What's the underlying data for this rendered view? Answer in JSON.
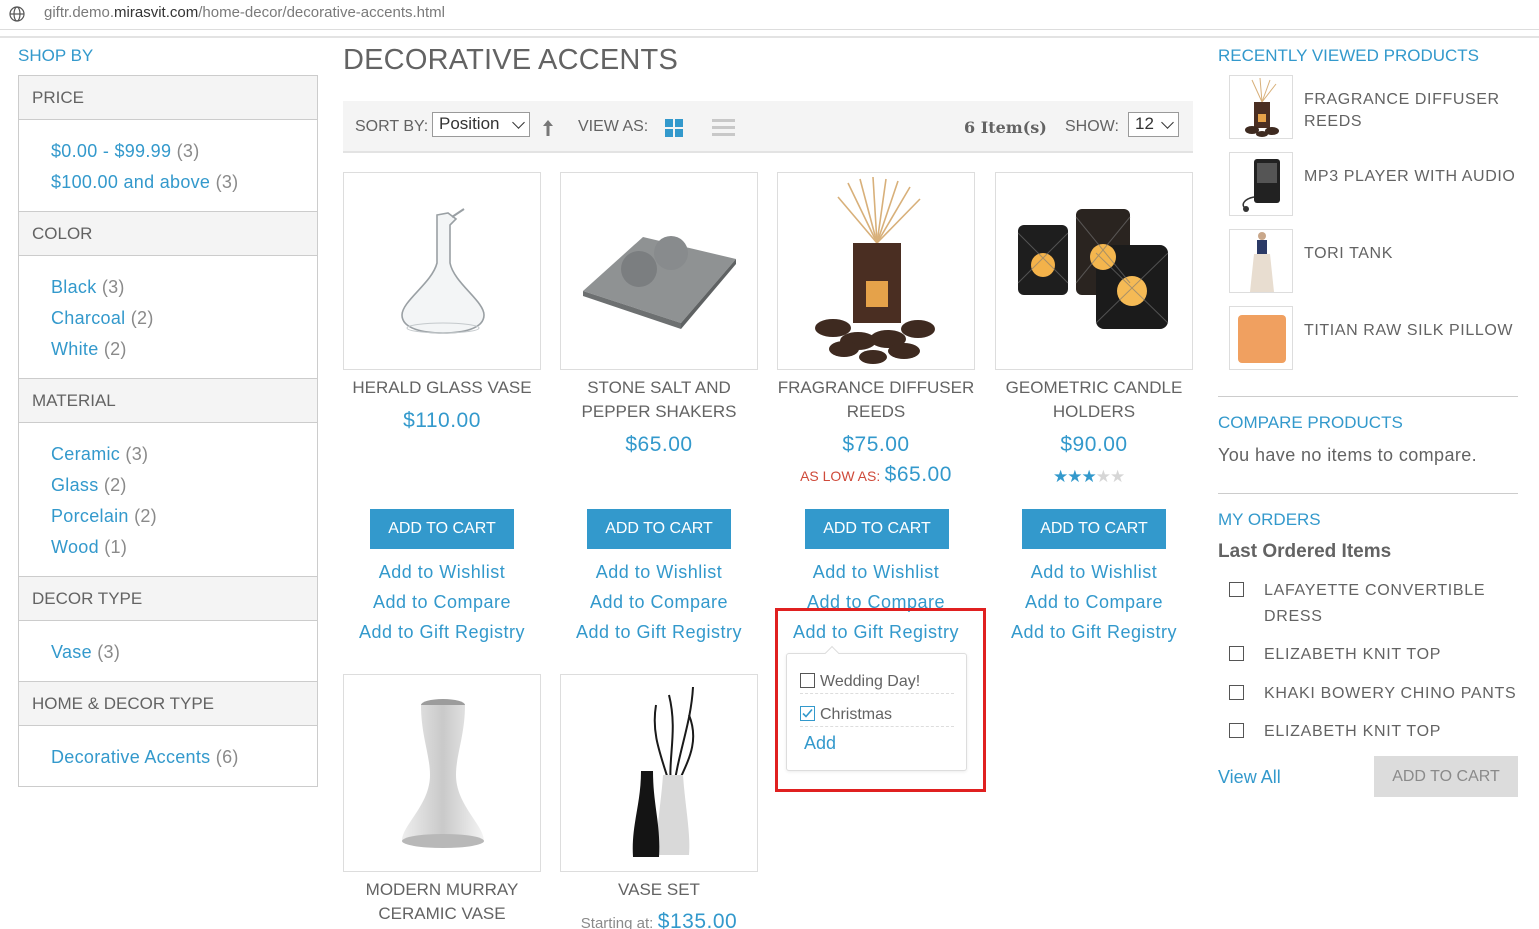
{
  "browser": {
    "url_prefix": "giftr.demo.",
    "url_domain": "mirasvit.com",
    "url_path": "/home-decor/decorative-accents.html"
  },
  "sidebar": {
    "title": "SHOP BY",
    "sections": [
      {
        "title": "PRICE",
        "items": [
          {
            "label": "$0.00 - $99.99",
            "count": "(3)"
          },
          {
            "label": "$100.00 and above",
            "count": "(3)"
          }
        ]
      },
      {
        "title": "COLOR",
        "items": [
          {
            "label": "Black",
            "count": "(3)"
          },
          {
            "label": "Charcoal",
            "count": "(2)"
          },
          {
            "label": "White",
            "count": "(2)"
          }
        ]
      },
      {
        "title": "MATERIAL",
        "items": [
          {
            "label": "Ceramic",
            "count": "(3)"
          },
          {
            "label": "Glass",
            "count": "(2)"
          },
          {
            "label": "Porcelain",
            "count": "(2)"
          },
          {
            "label": "Wood",
            "count": "(1)"
          }
        ]
      },
      {
        "title": "DECOR TYPE",
        "items": [
          {
            "label": "Vase",
            "count": "(3)"
          }
        ]
      },
      {
        "title": "HOME & DECOR TYPE",
        "items": [
          {
            "label": "Decorative Accents",
            "count": "(6)"
          }
        ]
      }
    ]
  },
  "main": {
    "title": "DECORATIVE ACCENTS",
    "toolbar": {
      "sort_label": "SORT BY:",
      "sort_value": "Position",
      "view_label": "VIEW AS:",
      "item_count": "6 Item(s)",
      "show_label": "SHOW:",
      "show_value": "12"
    },
    "products": [
      {
        "name": "HERALD GLASS VASE",
        "price": "$110.00"
      },
      {
        "name": "STONE SALT AND PEPPER SHAKERS",
        "price": "$65.00"
      },
      {
        "name": "FRAGRANCE DIFFUSER REEDS",
        "price": "$75.00",
        "as_low_label": "AS LOW AS:",
        "as_low_price": "$65.00"
      },
      {
        "name": "GEOMETRIC CANDLE HOLDERS",
        "price": "$90.00",
        "rating": 3,
        "rating_max": 5
      },
      {
        "name": "MODERN MURRAY CERAMIC VASE"
      },
      {
        "name": "VASE SET",
        "price_prefix": "Starting at:",
        "price": "$135.00"
      }
    ],
    "actions": {
      "add_to_cart": "ADD TO CART",
      "wishlist": "Add to Wishlist",
      "compare": "Add to Compare",
      "registry": "Add to Gift Registry"
    },
    "registry_popup": {
      "options": [
        {
          "label": "Wedding Day!",
          "checked": false
        },
        {
          "label": "Christmas",
          "checked": true
        }
      ],
      "add_label": "Add"
    }
  },
  "right": {
    "recently_viewed_title": "RECENTLY VIEWED PRODUCTS",
    "recently_viewed": [
      "FRAGRANCE DIFFUSER REEDS",
      "MP3 PLAYER WITH AUDIO",
      "TORI TANK",
      "TITIAN RAW SILK PILLOW"
    ],
    "compare_title": "COMPARE PRODUCTS",
    "compare_text": "You have no items to compare.",
    "orders_title": "MY ORDERS",
    "last_ordered_title": "Last Ordered Items",
    "last_ordered": [
      "LAFAYETTE CONVERTIBLE DRESS",
      "ELIZABETH KNIT TOP",
      "KHAKI BOWERY CHINO PANTS",
      "ELIZABETH KNIT TOP"
    ],
    "view_all": "View All",
    "add_to_cart": "ADD TO CART"
  },
  "colors": {
    "accent": "#3399cc",
    "text": "#636363",
    "sale_red": "#cf4a3a",
    "highlight_red": "#e02020"
  }
}
